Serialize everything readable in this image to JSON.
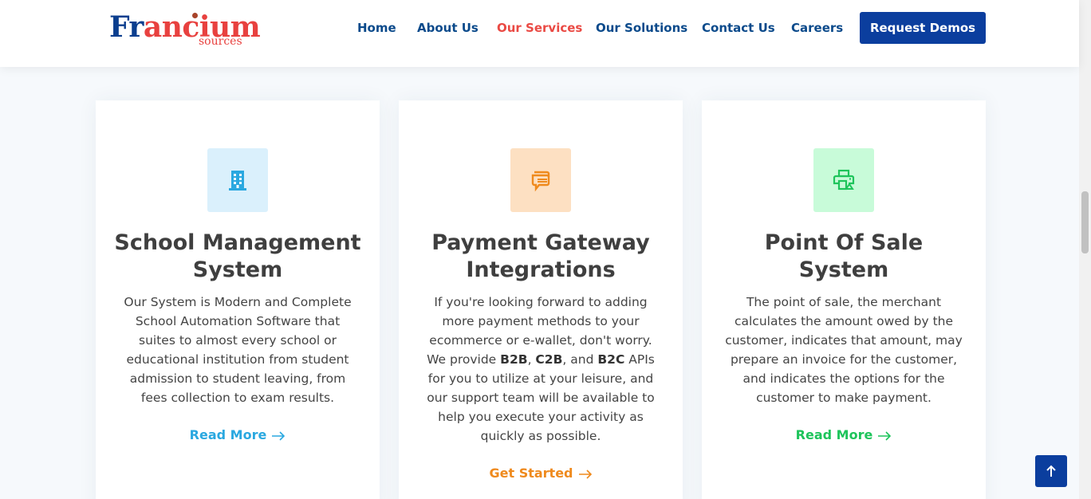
{
  "brand": {
    "name_first": "Fr",
    "name_rest": "ancium",
    "sub": "sources"
  },
  "nav": {
    "items": [
      {
        "label": "Home"
      },
      {
        "label": "About Us"
      },
      {
        "label": "Our Services",
        "active": true
      },
      {
        "label": "Our Solutions"
      },
      {
        "label": "Contact Us"
      },
      {
        "label": "Careers"
      }
    ],
    "cta_label": "Request Demos"
  },
  "colors": {
    "primary": "#0b3e9e",
    "accent_red": "#ea4a44",
    "card1_accent": "#2aa8e0",
    "card2_accent": "#ef8a1d",
    "card3_accent": "#1ec45b"
  },
  "cards": [
    {
      "icon": "building-icon",
      "title": "School Management System",
      "desc": "Our System is Modern and Complete School Automation Software that suites to almost every school or educational institution from student admission to student leaving, from fees collection to exam results.",
      "link": "Read More"
    },
    {
      "icon": "wallet-icon",
      "title": "Payment Gateway Integrations",
      "desc_part1": "If you're looking forward to adding more payment methods to your ecommerce or e-wallet, don't worry. We provide ",
      "desc_b1": "B2B",
      "desc_sep1": ", ",
      "desc_b2": "C2B",
      "desc_sep2": ", and ",
      "desc_b3": "B2C",
      "desc_part2": " APIs for you to utilize at your leisure, and our support team will be available to help you execute your activity as quickly as possible.",
      "link": "Get Started"
    },
    {
      "icon": "printer-icon",
      "title": "Point Of Sale System",
      "desc": "The point of sale, the merchant calculates the amount owed by the customer, indicates that amount, may prepare an invoice for the customer, and indicates the options for the customer to make payment.",
      "link": "Read More"
    }
  ],
  "back_to_top": "arrow-up-icon"
}
